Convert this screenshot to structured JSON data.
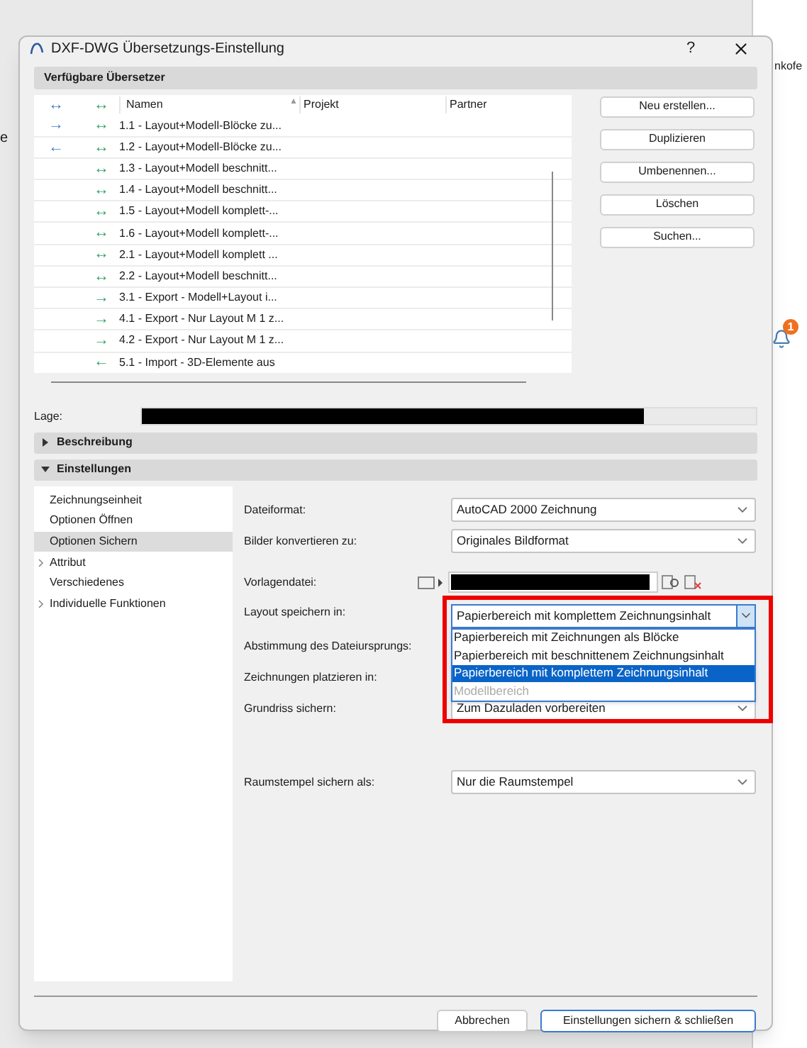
{
  "background": {
    "tab_text": "nkofe",
    "side_text": "e",
    "badge": "1"
  },
  "window": {
    "title": "DXF-DWG Übersetzungs-Einstellung",
    "help": "?"
  },
  "translators": {
    "title": "Verfügbare Übersetzer",
    "columns": [
      {
        "label": "↔"
      },
      {
        "label": "↔"
      },
      {
        "label": "Namen",
        "sorted": true,
        "sort_mark": "▲"
      },
      {
        "label": "Projekt"
      },
      {
        "label": "Partner"
      }
    ],
    "rows": [
      {
        "direction": "→",
        "mode": "↔",
        "name": "1.1 - Layout+Modell-Blöcke zu..."
      },
      {
        "direction": "←",
        "mode": "↔",
        "name": "1.2 - Layout+Modell-Blöcke zu..."
      },
      {
        "direction": "",
        "mode": "↔",
        "name": "1.3 - Layout+Modell beschnitt..."
      },
      {
        "direction": "",
        "mode": "↔",
        "name": "1.4 - Layout+Modell beschnitt..."
      },
      {
        "direction": "",
        "mode": "↔",
        "name": "1.5 - Layout+Modell komplett-..."
      },
      {
        "direction": "",
        "mode": "↔",
        "name": "1.6 - Layout+Modell komplett-..."
      },
      {
        "direction": "",
        "mode": "↔",
        "name": "2.1 - Layout+Modell komplett ..."
      },
      {
        "direction": "",
        "mode": "↔",
        "name": "2.2 - Layout+Modell beschnitt..."
      },
      {
        "direction": "",
        "mode": "→",
        "name": "3.1 - Export - Modell+Layout i..."
      },
      {
        "direction": "",
        "mode": "→",
        "name": "4.1 - Export - Nur Layout M 1 z..."
      },
      {
        "direction": "",
        "mode": "→",
        "name": "4.2 - Export - Nur Layout M 1 z..."
      },
      {
        "direction": "",
        "mode": "←",
        "name": "5.1 - Import - 3D-Elemente aus"
      }
    ],
    "buttons": [
      "Neu erstellen...",
      "Duplizieren",
      "Umbenennen...",
      "Löschen",
      "Suchen..."
    ]
  },
  "location": {
    "label": "Lage:"
  },
  "sections": [
    {
      "label": "Beschreibung",
      "expanded": false
    },
    {
      "label": "Einstellungen",
      "expanded": true
    }
  ],
  "settings_tree": [
    {
      "label": "Zeichnungseinheit",
      "expandable": false,
      "selected": false
    },
    {
      "label": "Optionen Öffnen",
      "expandable": false,
      "selected": false
    },
    {
      "label": "Optionen Sichern",
      "expandable": false,
      "selected": true
    },
    {
      "label": "Attribut",
      "expandable": true,
      "selected": false
    },
    {
      "label": "Verschiedenes",
      "expandable": false,
      "selected": false
    },
    {
      "label": "Individuelle Funktionen",
      "expandable": true,
      "selected": false
    }
  ],
  "fields": [
    {
      "kind": "select",
      "label": "Dateiformat:",
      "value": "AutoCAD 2000 Zeichnung"
    },
    {
      "kind": "select",
      "label": "Bilder konvertieren zu:",
      "value": "Originales Bildformat"
    },
    {
      "kind": "file",
      "label": "Vorlagendatei:"
    },
    {
      "kind": "open_select",
      "label": "Layout speichern in:",
      "value": "Papierbereich mit komplettem Zeichnungsinhalt",
      "options": [
        {
          "label": "Papierbereich mit Zeichnungen als Blöcke",
          "selected": false,
          "disabled": false
        },
        {
          "label": "Papierbereich mit beschnittenem Zeichnungsinhalt",
          "selected": false,
          "disabled": false
        },
        {
          "label": "Papierbereich mit komplettem Zeichnungsinhalt",
          "selected": true,
          "disabled": false
        },
        {
          "label": "Modellbereich",
          "selected": false,
          "disabled": true
        }
      ]
    },
    {
      "kind": "hidden",
      "label": "Abstimmung des Dateiursprungs:"
    },
    {
      "kind": "hidden",
      "label": "Zeichnungen platzieren in:"
    },
    {
      "kind": "select",
      "label": "Grundriss sichern:",
      "value": "Zum Dazuladen vorbereiten"
    },
    {
      "kind": "spacer"
    },
    {
      "kind": "select",
      "label": "Raumstempel sichern als:",
      "value": "Nur die Raumstempel"
    }
  ],
  "footer": {
    "cancel": "Abbrechen",
    "confirm": "Einstellungen sichern & schließen"
  }
}
